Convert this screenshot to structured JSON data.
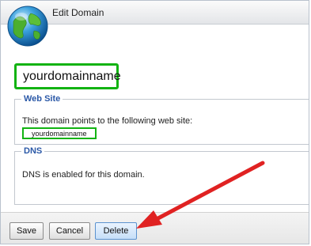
{
  "dialog": {
    "title": "Edit Domain",
    "domain_name": "yourdomainname",
    "icon": "globe-icon"
  },
  "website": {
    "legend": "Web Site",
    "description": "This domain points to the following web site:",
    "site_name": "yourdomainname"
  },
  "dns": {
    "legend": "DNS",
    "description": "DNS is enabled for this domain."
  },
  "buttons": {
    "save": "Save",
    "cancel": "Cancel",
    "delete": "Delete"
  },
  "annotation": {
    "arrow_color": "#e02222",
    "highlight_color": "#12b312",
    "target": "delete-button"
  },
  "colors": {
    "legend_text": "#2a58a7",
    "delete_highlight": "#c6def7"
  }
}
